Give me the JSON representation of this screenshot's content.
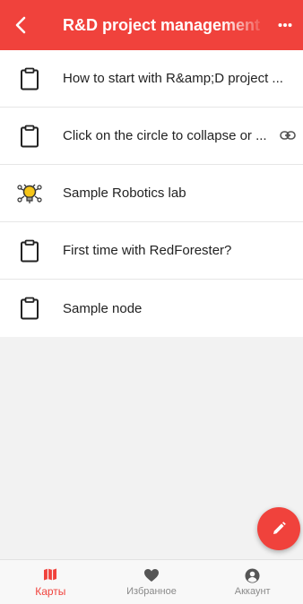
{
  "header": {
    "back_icon": "chevron-left-icon",
    "title": "R&D project management",
    "more_icon": "more-horizontal-icon",
    "bg_color": "#f0423c"
  },
  "list": {
    "items": [
      {
        "icon": "clipboard-icon",
        "label": "How to start with R&amp;D project ..."
      },
      {
        "icon": "clipboard-icon",
        "label": "Click on the circle to collapse or ...",
        "trailing_icon": "link-icon"
      },
      {
        "icon": "robot-lightbulb-icon",
        "label": "Sample Robotics lab"
      },
      {
        "icon": "clipboard-icon",
        "label": "First time with RedForester?"
      },
      {
        "icon": "clipboard-icon",
        "label": "Sample node"
      }
    ]
  },
  "fab": {
    "icon": "pencil-icon"
  },
  "bottom_nav": {
    "items": [
      {
        "icon": "map-icon",
        "label": "Карты",
        "active": true
      },
      {
        "icon": "heart-icon",
        "label": "Избранное",
        "active": false
      },
      {
        "icon": "account-icon",
        "label": "Аккаунт",
        "active": false
      }
    ]
  }
}
